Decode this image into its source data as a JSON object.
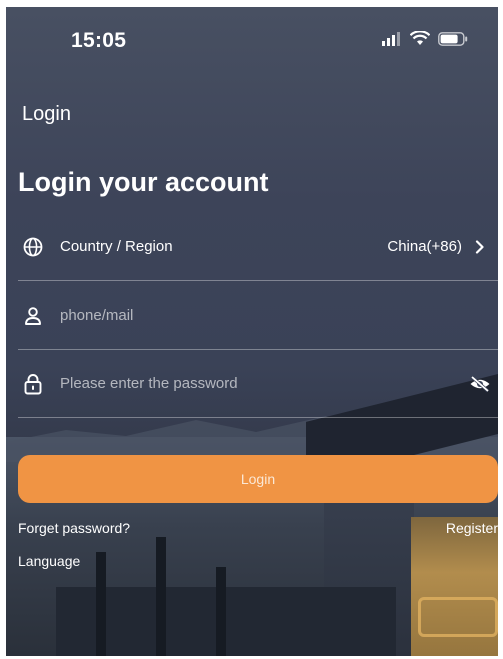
{
  "status_bar": {
    "time": "15:05"
  },
  "nav": {
    "title": "Login"
  },
  "page": {
    "heading": "Login your account"
  },
  "form": {
    "country": {
      "label": "Country / Region",
      "value": "China(+86)"
    },
    "account": {
      "placeholder": "phone/mail",
      "value": ""
    },
    "password": {
      "placeholder": "Please enter the password",
      "value": ""
    },
    "login_label": "Login"
  },
  "links": {
    "forget_password": "Forget password?",
    "register": "Register",
    "language": "Language"
  },
  "colors": {
    "accent": "#f09444",
    "text": "#ffffff",
    "divider": "rgba(255,255,255,0.35)"
  },
  "icons": {
    "country": "globe-icon",
    "account": "user-icon",
    "password": "lock-icon",
    "visibility": "eye-off-icon",
    "chevron": "chevron-right-icon"
  }
}
